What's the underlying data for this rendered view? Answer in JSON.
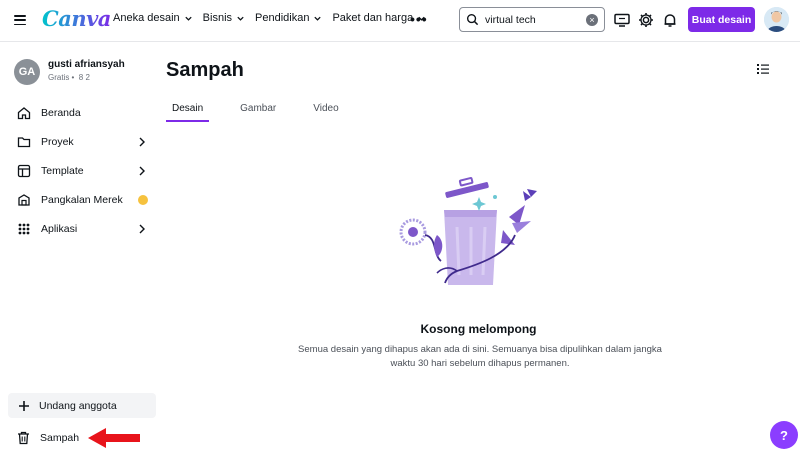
{
  "app": {
    "logo": "Canva"
  },
  "nav": {
    "items": [
      {
        "label": "Aneka desain"
      },
      {
        "label": "Bisnis"
      },
      {
        "label": "Pendidikan"
      },
      {
        "label": "Paket dan harga"
      }
    ],
    "more": "•••"
  },
  "search": {
    "value": "virtual tech",
    "clear": "×"
  },
  "header": {
    "cta_label": "Buat desain",
    "icons": [
      "monitor-icon",
      "gear-icon",
      "bell-icon"
    ]
  },
  "profile": {
    "initials": "GA",
    "name": "gusti afriansyah",
    "sub": "Gratis • ‍ 8 2"
  },
  "sidebar": {
    "items": [
      {
        "label": "Beranda",
        "icon": "home-icon"
      },
      {
        "label": "Proyek",
        "icon": "folder-icon"
      },
      {
        "label": "Template",
        "icon": "template-icon"
      },
      {
        "label": "Pangkalan Merek",
        "icon": "brand-icon"
      },
      {
        "label": "Aplikasi",
        "icon": "apps-icon"
      }
    ],
    "invite_label": "Undang anggota",
    "trash_label": "Sampah"
  },
  "main": {
    "title": "Sampah",
    "tabs": [
      {
        "label": "Desain"
      },
      {
        "label": "Gambar"
      },
      {
        "label": "Video"
      }
    ],
    "empty_title": "Kosong melompong",
    "empty_desc": "Semua desain yang dihapus akan ada di sini. Semuanya bisa dipulihkan dalam jangka waktu 30 hari sebelum dihapus permanen."
  },
  "help": {
    "label": "?"
  },
  "colors": {
    "accent": "#7d2ae8",
    "annotation": "#e8141b"
  }
}
